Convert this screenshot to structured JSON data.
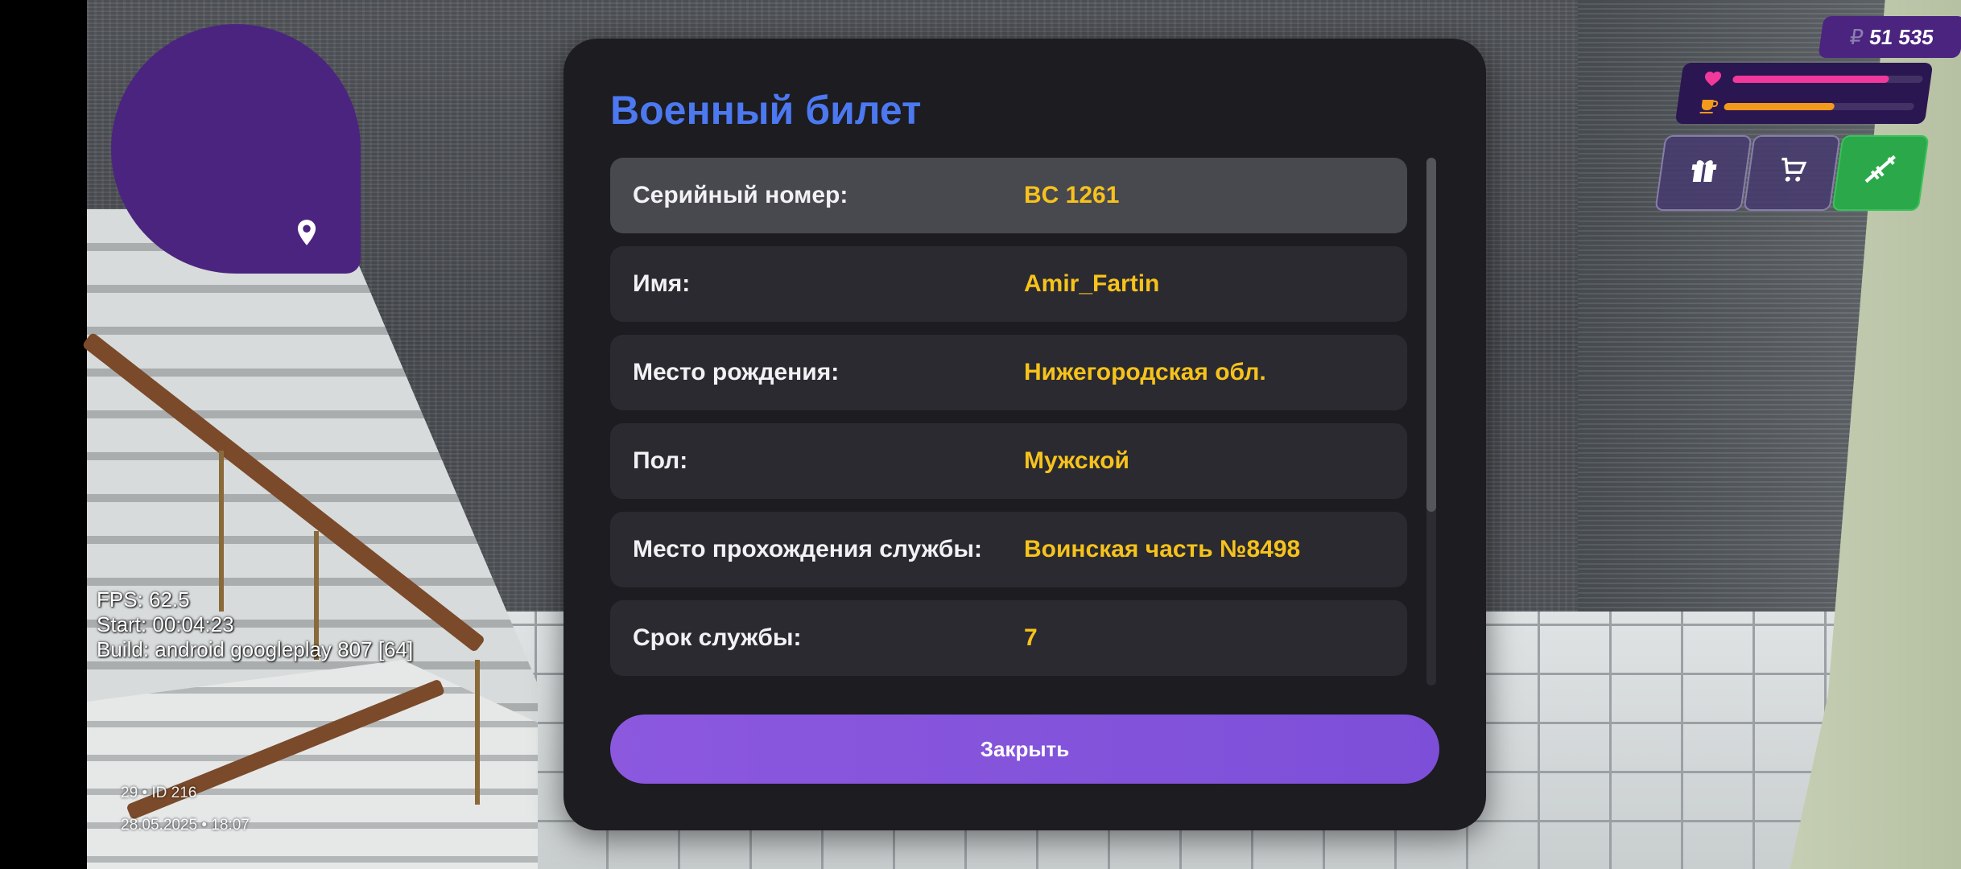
{
  "modal": {
    "title": "Военный билет",
    "rows": [
      {
        "label": "Серийный номер:",
        "value": "BC 1261"
      },
      {
        "label": "Имя:",
        "value": "Amir_Fartin"
      },
      {
        "label": "Место рождения:",
        "value": "Нижегородская обл."
      },
      {
        "label": "Пол:",
        "value": "Мужской"
      },
      {
        "label": "Место прохождения службы:",
        "value": "Воинская часть №8498"
      },
      {
        "label": "Срок службы:",
        "value": "7"
      }
    ],
    "close_label": "Закрыть",
    "accent_color": "#4c78f0",
    "value_color": "#f6c21c",
    "button_color": "#8b58de"
  },
  "hud": {
    "money": "51 535",
    "currency_symbol": "₽",
    "health_level": 0.82,
    "hunger_level": 0.58,
    "health_color": "#f0399a",
    "hunger_color": "#f39a1d",
    "icons": [
      "heart-icon",
      "coffee-icon",
      "gift-icon",
      "cart-icon",
      "weapon-icon",
      "location-pin-icon"
    ]
  },
  "debug": {
    "fps": "FPS: 62.5",
    "start": "Start: 00:04:23",
    "build": "Build: android googleplay 807 [64]"
  },
  "footer": {
    "id_line": "29 • ID 216",
    "datetime": "28.05.2025 • 18:07"
  }
}
